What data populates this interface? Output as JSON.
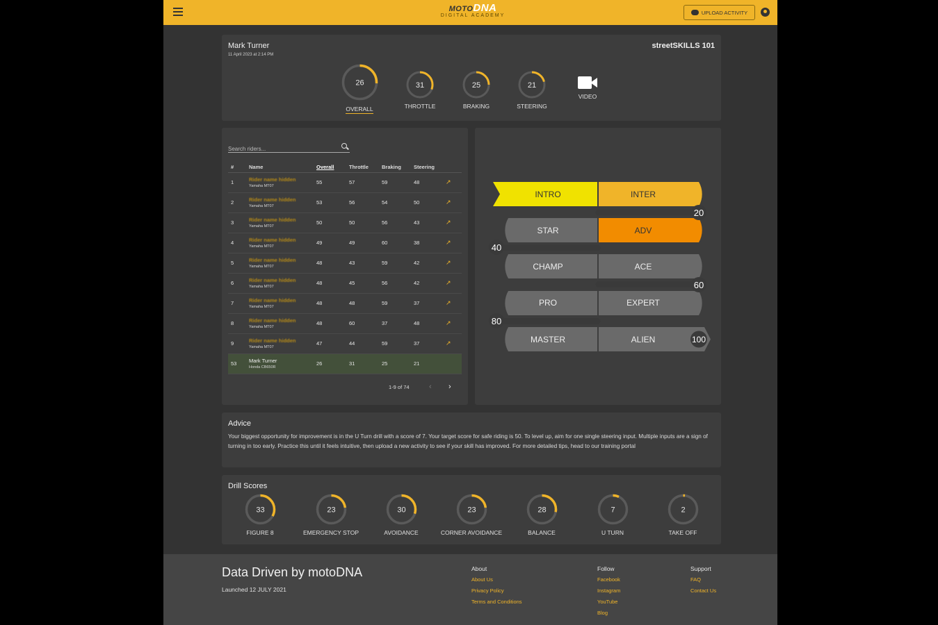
{
  "header": {
    "logo_main": "motoDNA",
    "logo_moto": "MOTO",
    "logo_dna": "DNA",
    "logo_sub": "DIGITAL ACADEMY",
    "upload_label": "UPLOAD ACTIVITY",
    "accent": "#f0b429"
  },
  "profile": {
    "name": "Mark Turner",
    "date": "11 April 2023 at 2:14 PM",
    "course": "streetSKILLS 101",
    "scores": [
      {
        "label": "OVERALL",
        "value": 26,
        "active": true
      },
      {
        "label": "THROTTLE",
        "value": 31
      },
      {
        "label": "BRAKING",
        "value": 25
      },
      {
        "label": "STEERING",
        "value": 21
      },
      {
        "label": "VIDEO",
        "icon": "video-camera-icon"
      }
    ]
  },
  "leaderboard": {
    "search_placeholder": "Search riders...",
    "columns": [
      "#",
      "Name",
      "Overall",
      "Throttle",
      "Braking",
      "Steering"
    ],
    "rows": [
      {
        "rank": "1",
        "name": "Rider name hidden",
        "bike": "Yamaha MT07",
        "overall": "55",
        "throttle": "57",
        "braking": "59",
        "steering": "48"
      },
      {
        "rank": "2",
        "name": "Rider name hidden",
        "bike": "Yamaha MT07",
        "overall": "53",
        "throttle": "56",
        "braking": "54",
        "steering": "50"
      },
      {
        "rank": "3",
        "name": "Rider name hidden",
        "bike": "Yamaha MT07",
        "overall": "50",
        "throttle": "50",
        "braking": "56",
        "steering": "43"
      },
      {
        "rank": "4",
        "name": "Rider name hidden",
        "bike": "Yamaha MT07",
        "overall": "49",
        "throttle": "49",
        "braking": "60",
        "steering": "38"
      },
      {
        "rank": "5",
        "name": "Rider name hidden",
        "bike": "Yamaha MT07",
        "overall": "48",
        "throttle": "43",
        "braking": "59",
        "steering": "42"
      },
      {
        "rank": "6",
        "name": "Rider name hidden",
        "bike": "Yamaha MT07",
        "overall": "48",
        "throttle": "45",
        "braking": "56",
        "steering": "42"
      },
      {
        "rank": "7",
        "name": "Rider name hidden",
        "bike": "Yamaha MT07",
        "overall": "48",
        "throttle": "48",
        "braking": "59",
        "steering": "37"
      },
      {
        "rank": "8",
        "name": "Rider name hidden",
        "bike": "Yamaha MT07",
        "overall": "48",
        "throttle": "60",
        "braking": "37",
        "steering": "48"
      },
      {
        "rank": "9",
        "name": "Rider name hidden",
        "bike": "Yamaha MT07",
        "overall": "47",
        "throttle": "44",
        "braking": "59",
        "steering": "37"
      },
      {
        "rank": "53",
        "name": "Mark Turner",
        "bike": "Honda CB650R",
        "overall": "26",
        "throttle": "31",
        "braking": "25",
        "steering": "21",
        "me": true
      }
    ],
    "pager": "1-9 of 74"
  },
  "levels": {
    "names": [
      "INTRO",
      "INTER",
      "STAR",
      "ADV",
      "CHAMP",
      "ACE",
      "PRO",
      "EXPERT",
      "MASTER",
      "ALIEN"
    ],
    "markers": [
      "20",
      "40",
      "60",
      "80",
      "100"
    ],
    "colors": {
      "intro": "#f0e200",
      "inter": "#f0b429",
      "adv": "#f28c00",
      "locked": "#6a6a6a"
    }
  },
  "advice": {
    "title": "Advice",
    "text": "Your biggest opportunity for improvement is in the U Turn drill with a score of 7. Your target score for safe riding is 50. To level up, aim for one single steering input. Multiple inputs are a sign of turning in too early. Practice this until it feels intuitive, then upload a new activity to see if your skill has improved. For more detailed tips, head to our training portal"
  },
  "drills": {
    "title": "Drill Scores",
    "items": [
      {
        "label": "FIGURE 8",
        "value": 33
      },
      {
        "label": "EMERGENCY STOP",
        "value": 23
      },
      {
        "label": "AVOIDANCE",
        "value": 30
      },
      {
        "label": "CORNER AVOIDANCE",
        "value": 23
      },
      {
        "label": "BALANCE",
        "value": 28
      },
      {
        "label": "U TURN",
        "value": 7
      },
      {
        "label": "TAKE OFF",
        "value": 2
      }
    ]
  },
  "footer": {
    "title": "Data Driven by motoDNA",
    "launched": "Launched 12 JULY 2021",
    "about": {
      "heading": "About",
      "links": [
        "About Us",
        "Privacy Policy",
        "Terms and Conditions"
      ]
    },
    "follow": {
      "heading": "Follow",
      "links": [
        "Facebook",
        "Instagram",
        "YouTube",
        "Blog"
      ]
    },
    "support": {
      "heading": "Support",
      "links": [
        "FAQ",
        "Contact Us"
      ]
    }
  }
}
